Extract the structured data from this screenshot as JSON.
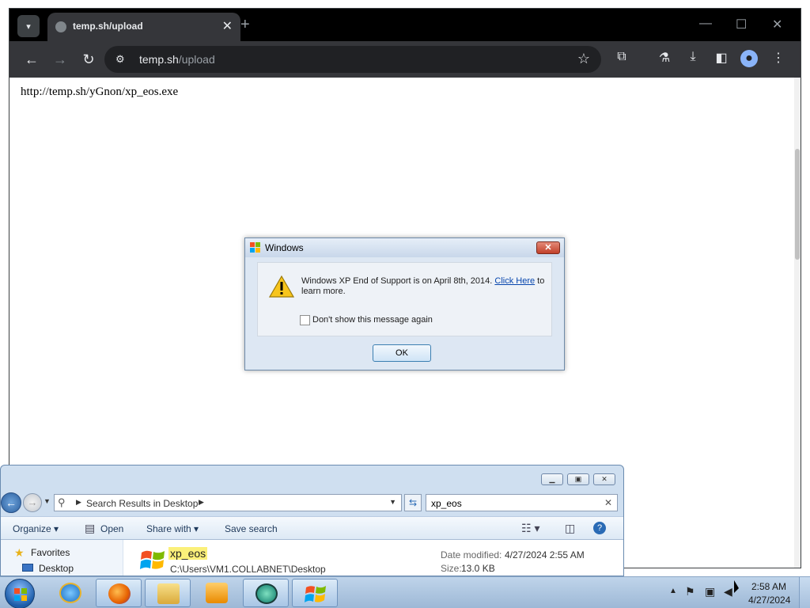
{
  "browser": {
    "tab_title": "temp.sh/upload",
    "tab_close": "✕",
    "new_tab": "+",
    "url_host": "temp.sh",
    "url_path": "/upload",
    "page_text": "http://temp.sh/yGnon/xp_eos.exe",
    "controls": {
      "minimize": "—",
      "maximize": "☐",
      "close": "✕"
    }
  },
  "dialog": {
    "title": "Windows",
    "close": "✕",
    "message_before_link": "Windows XP End of Support is on April 8th, 2014. ",
    "link": "Click Here",
    "message_after_link": " to learn more.",
    "checkbox_label": "Don't show this message again",
    "checkbox_checked": false,
    "ok_label": "OK"
  },
  "explorer": {
    "address": "Search Results in Desktop",
    "search_value": "xp_eos",
    "commands": {
      "organize": "Organize ▾",
      "open": "Open",
      "share_with": "Share with ▾",
      "save_search": "Save search"
    },
    "nav": {
      "favorites": "Favorites",
      "desktop": "Desktop"
    },
    "result": {
      "name": "xp_eos",
      "path": "C:\\Users\\VM1.COLLABNET\\Desktop",
      "date_label": "Date modified:",
      "date_value": "4/27/2024 2:55 AM",
      "size_label": "Size:",
      "size_value": "13.0 KB"
    }
  },
  "taskbar": {
    "time": "2:58 AM",
    "date": "4/27/2024",
    "apps": [
      "internet-explorer",
      "firefox",
      "file-explorer",
      "media-player",
      "app-globe",
      "windows-xp-eos"
    ]
  },
  "colors": {
    "chrome_dark": "#202124",
    "dialog_bg": "#dde7f3",
    "highlight": "#fbf07a",
    "taskbar": "#bfd4ea"
  }
}
